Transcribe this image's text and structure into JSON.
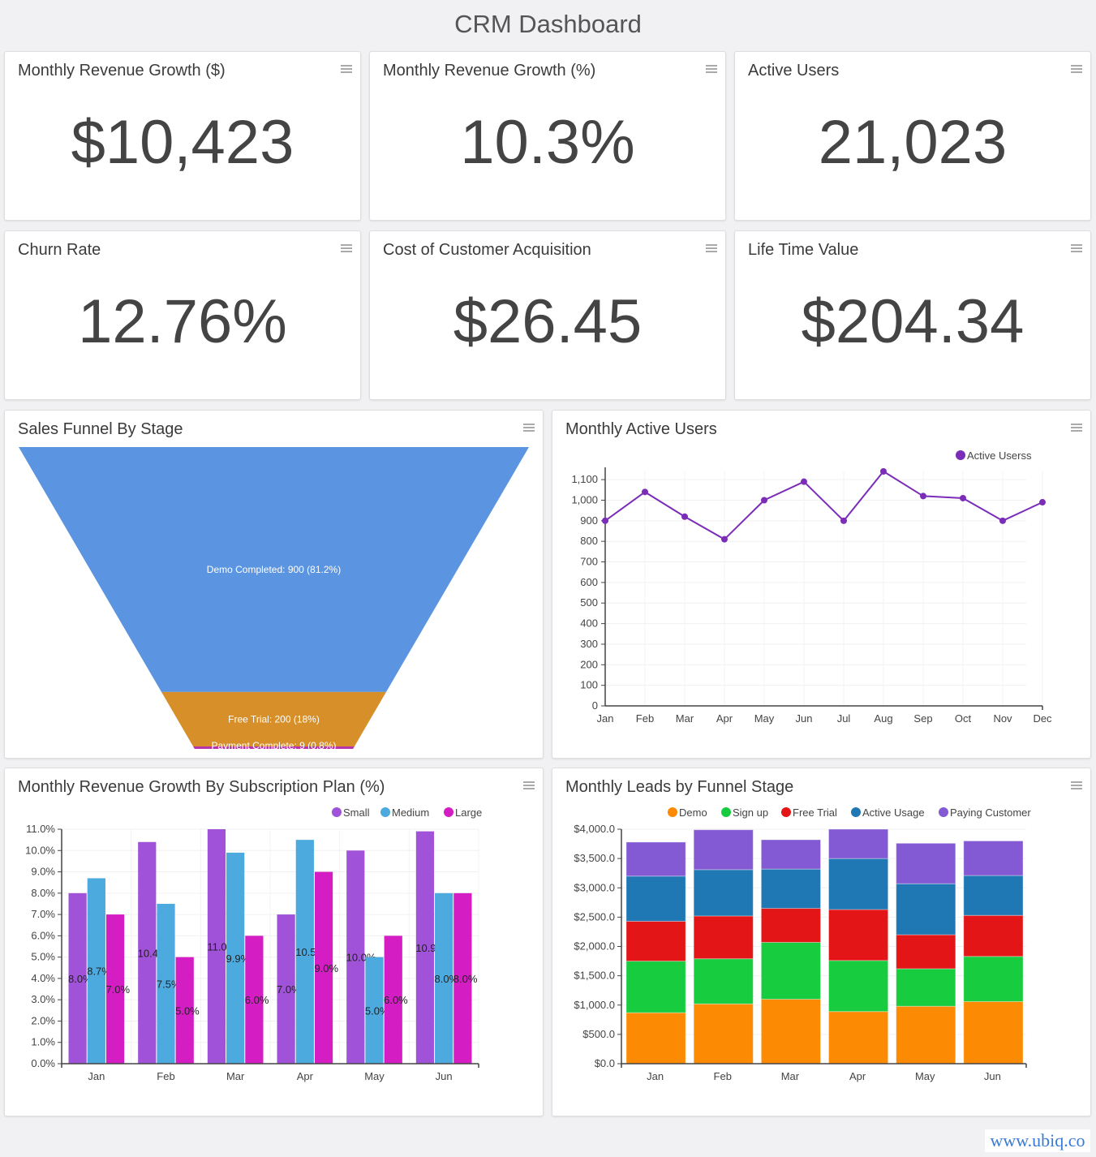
{
  "page": {
    "title": "CRM Dashboard"
  },
  "kpis": [
    {
      "title": "Monthly Revenue Growth ($)",
      "value": "$10,423"
    },
    {
      "title": "Monthly Revenue Growth (%)",
      "value": "10.3%"
    },
    {
      "title": "Active Users",
      "value": "21,023"
    },
    {
      "title": "Churn Rate",
      "value": "12.76%"
    },
    {
      "title": "Cost of Customer Acquisition",
      "value": "$26.45"
    },
    {
      "title": "Life Time Value",
      "value": "$204.34"
    }
  ],
  "panels": {
    "funnel": {
      "title": "Sales Funnel By Stage"
    },
    "line": {
      "title": "Monthly Active Users"
    },
    "bars": {
      "title": "Monthly Revenue Growth By Subscription Plan (%)"
    },
    "stacked": {
      "title": "Monthly Leads by Funnel Stage"
    }
  },
  "watermark": "www.ubiq.co",
  "chart_data": [
    {
      "id": "funnel",
      "type": "funnel",
      "title": "Sales Funnel By Stage",
      "stages": [
        {
          "label": "Demo Completed",
          "value": 900,
          "percent": "81.2%",
          "color": "#5b95e2",
          "display": "Demo Completed: 900 (81.2%)"
        },
        {
          "label": "Free Trial",
          "value": 200,
          "percent": "18%",
          "color": "#d68f29",
          "display": "Free Trial: 200 (18%)"
        },
        {
          "label": "Payment Complete",
          "value": 9,
          "percent": "0.8%",
          "color": "#b635ad",
          "display": "Payment Complete: 9 (0.8%)"
        }
      ]
    },
    {
      "id": "line",
      "type": "line",
      "title": "Monthly Active Users",
      "legend": [
        "Active Userss"
      ],
      "legend_position": "top-right",
      "color": "#7b2db8",
      "x": [
        "Jan",
        "Feb",
        "Mar",
        "Apr",
        "May",
        "Jun",
        "Jul",
        "Aug",
        "Sep",
        "Oct",
        "Nov",
        "Dec"
      ],
      "values": [
        900,
        1040,
        920,
        810,
        1000,
        1090,
        900,
        1140,
        1020,
        1010,
        900,
        990
      ],
      "ylim": [
        0,
        1140
      ],
      "yticks": [
        0,
        100,
        200,
        300,
        400,
        500,
        600,
        700,
        800,
        900,
        1000,
        1100
      ],
      "ytick_labels": [
        "0",
        "100",
        "200",
        "300",
        "400",
        "500",
        "600",
        "700",
        "800",
        "900",
        "1,000",
        "1,100"
      ],
      "grid": true
    },
    {
      "id": "bars",
      "type": "bar",
      "title": "Monthly Revenue Growth By Subscription Plan (%)",
      "categories": [
        "Jan",
        "Feb",
        "Mar",
        "Apr",
        "May",
        "Jun"
      ],
      "legend_position": "top-right",
      "series": [
        {
          "name": "Small",
          "color": "#a052d8",
          "values": [
            8.0,
            10.4,
            11.0,
            7.0,
            10.0,
            10.9
          ],
          "labels": [
            "8.0%",
            "10.4",
            "11.0",
            "7.0%",
            "10.0%",
            "10.9"
          ]
        },
        {
          "name": "Medium",
          "color": "#4daadf",
          "values": [
            8.7,
            7.5,
            9.9,
            10.5,
            5.0,
            8.0
          ],
          "labels": [
            "8.7%",
            "7.5%",
            "9.9%",
            "10.5",
            "5.0%",
            "8.0%"
          ]
        },
        {
          "name": "Large",
          "color": "#d41ec4",
          "values": [
            7.0,
            5.0,
            6.0,
            9.0,
            6.0,
            8.0
          ],
          "labels": [
            "7.0%",
            "5.0%",
            "6.0%",
            "9.0%",
            "6.0%",
            "8.0%"
          ]
        }
      ],
      "ylim": [
        0,
        11
      ],
      "yticks": [
        0,
        1,
        2,
        3,
        4,
        5,
        6,
        7,
        8,
        9,
        10,
        11
      ],
      "ytick_labels": [
        "0.0%",
        "1.0%",
        "2.0%",
        "3.0%",
        "4.0%",
        "5.0%",
        "6.0%",
        "7.0%",
        "8.0%",
        "9.0%",
        "10.0%",
        "11.0%"
      ],
      "grid": true
    },
    {
      "id": "stacked",
      "type": "stacked-bar",
      "title": "Monthly Leads by Funnel Stage",
      "categories": [
        "Jan",
        "Feb",
        "Mar",
        "Apr",
        "May",
        "Jun"
      ],
      "legend_position": "top-right",
      "series": [
        {
          "name": "Demo",
          "color": "#fd8a03",
          "values": [
            870,
            1020,
            1100,
            890,
            980,
            1060
          ]
        },
        {
          "name": "Sign up",
          "color": "#17cc3f",
          "values": [
            880,
            770,
            970,
            870,
            640,
            770
          ]
        },
        {
          "name": "Free Trial",
          "color": "#e31516",
          "values": [
            680,
            730,
            580,
            870,
            580,
            700
          ]
        },
        {
          "name": "Active Usage",
          "color": "#1f77b4",
          "values": [
            770,
            790,
            670,
            870,
            870,
            680
          ]
        },
        {
          "name": "Paying Customer",
          "color": "#835ad4",
          "values": [
            580,
            680,
            500,
            500,
            690,
            590
          ]
        }
      ],
      "ylim": [
        0,
        4000
      ],
      "yticks": [
        0,
        500,
        1000,
        1500,
        2000,
        2500,
        3000,
        3500,
        4000
      ],
      "ytick_labels": [
        "$0.0",
        "$500.0",
        "$1,000.0",
        "$1,500.0",
        "$2,000.0",
        "$2,500.0",
        "$3,000.0",
        "$3,500.0",
        "$4,000.0"
      ],
      "grid": true
    }
  ]
}
